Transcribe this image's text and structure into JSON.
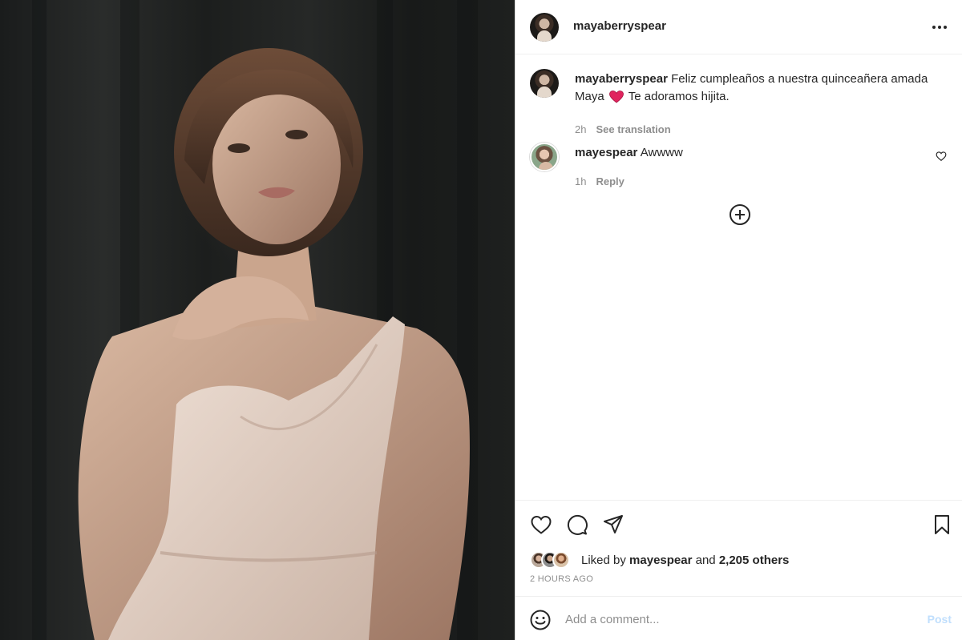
{
  "post": {
    "author": "mayaberryspear",
    "photo_icon": "portrait-photo"
  },
  "caption": {
    "username": "mayaberryspear",
    "text_before_emoji": " Feliz cumpleaños a nuestra quinceañera amada Maya",
    "emoji": "heart-emoji",
    "text_after_emoji": " Te adoramos hijita.",
    "time": "2h",
    "see_translation": "See translation"
  },
  "comments": [
    {
      "username": "mayespear",
      "text": " Awwww",
      "time": "1h",
      "reply": "Reply"
    }
  ],
  "likes": {
    "prefix": "Liked by ",
    "first_user": "mayespear",
    "joiner": " and ",
    "others": "2,205 others"
  },
  "timestamp": "2 HOURS AGO",
  "add_comment": {
    "placeholder": "Add a comment...",
    "post_label": "Post"
  },
  "colors": {
    "text": "#262626",
    "muted": "#8e8e8e",
    "border": "#dbdbdb",
    "post_button_disabled": "#c0dffd",
    "heart": "#e0245e"
  }
}
